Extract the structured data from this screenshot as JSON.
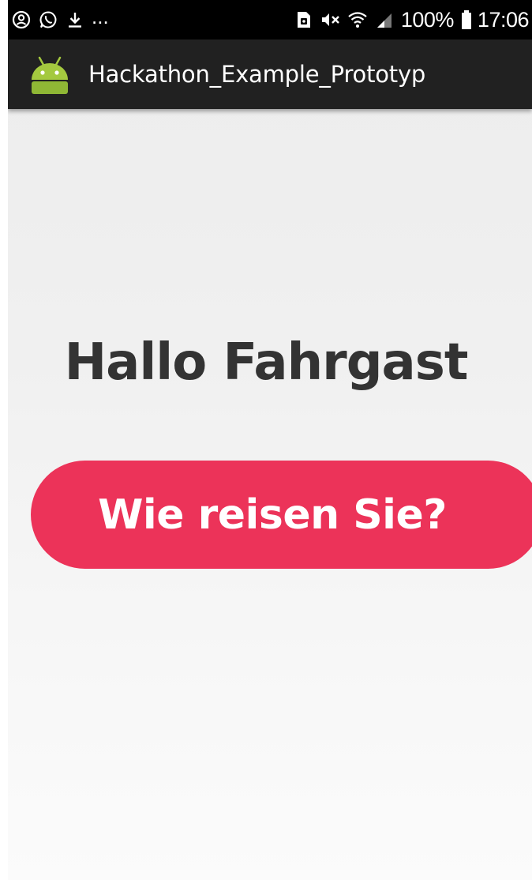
{
  "status_bar": {
    "left_icons": [
      "account-circle-icon",
      "whatsapp-icon",
      "download-icon"
    ],
    "overflow": "...",
    "right_icons": [
      "sim-card-icon",
      "mute-icon",
      "wifi-icon",
      "cell-signal-icon",
      "battery-icon"
    ],
    "battery": "100%",
    "time": "17:06"
  },
  "action_bar": {
    "app_icon": "android-robot-icon",
    "title": "Hackathon_Example_Prototyp",
    "background_color": "#212121"
  },
  "main": {
    "greeting": "Hallo Fahrgast",
    "button_label": "Wie reisen Sie?",
    "button_color": "#ec3359"
  }
}
